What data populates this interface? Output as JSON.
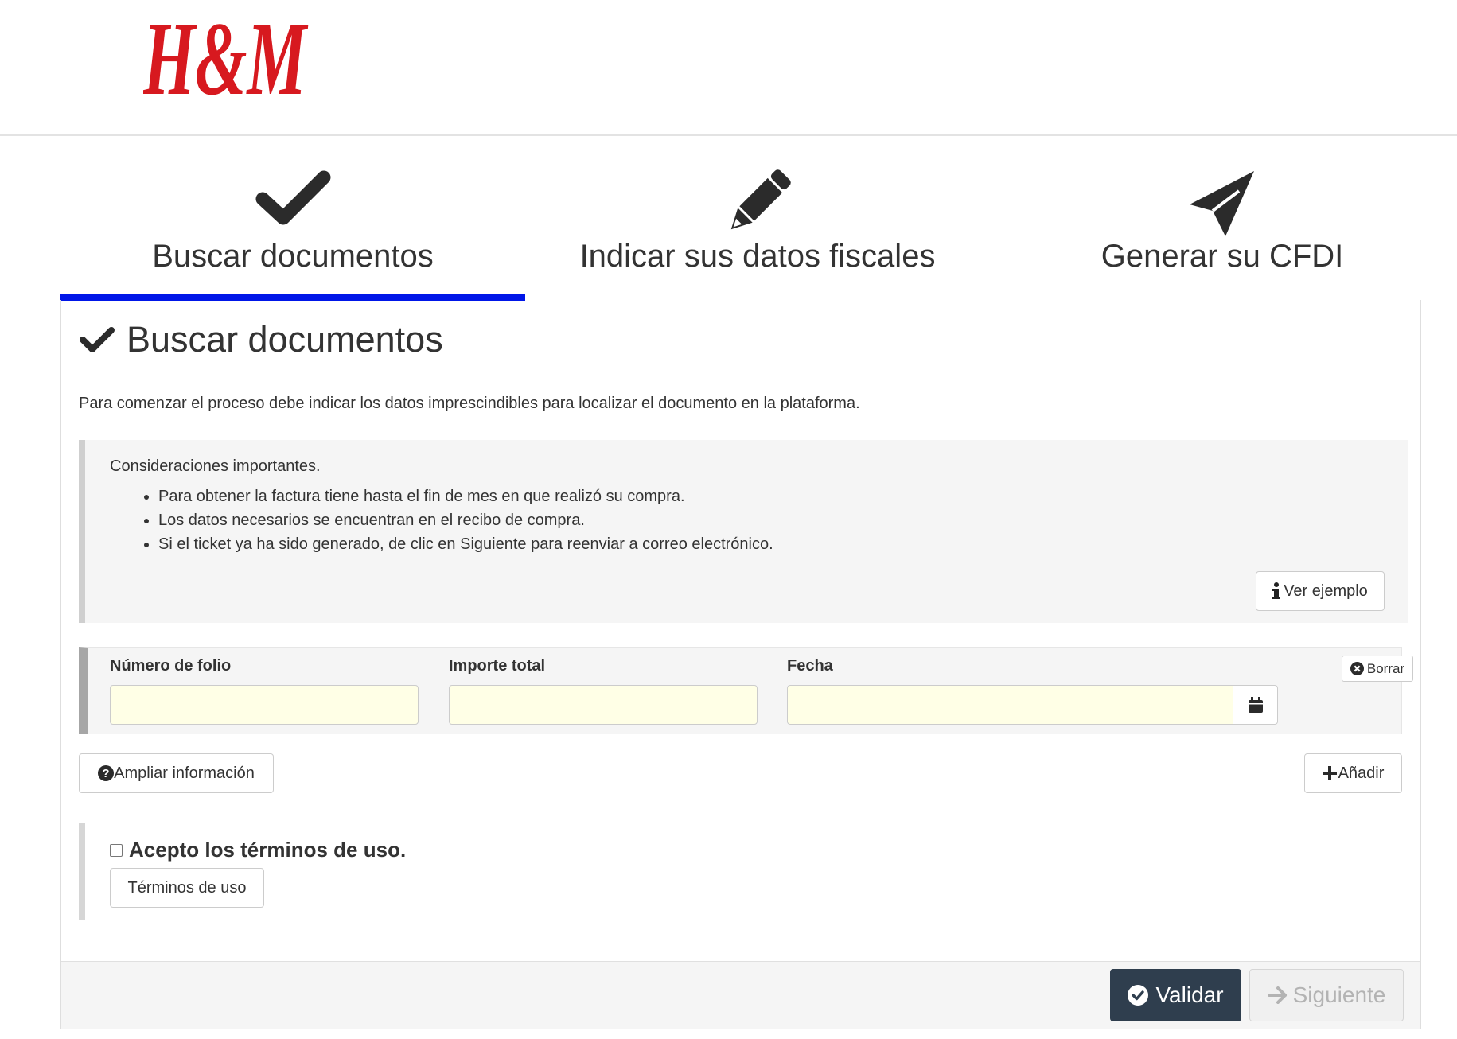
{
  "brand": {
    "logo_text": "H&M",
    "logo_color": "#d7191f"
  },
  "steps": [
    {
      "label": "Buscar documentos",
      "icon": "check-icon",
      "active": true
    },
    {
      "label": "Indicar sus datos fiscales",
      "icon": "pencil-icon",
      "active": false
    },
    {
      "label": "Generar su CFDI",
      "icon": "paper-plane-icon",
      "active": false
    }
  ],
  "accent_color": "#0016e8",
  "section": {
    "title": "Buscar documentos",
    "intro": "Para comenzar el proceso debe indicar los datos imprescindibles para localizar el documento en la plataforma."
  },
  "considerations": {
    "title": "Consideraciones importantes.",
    "items": [
      "Para obtener la factura tiene hasta el fin de mes en que realizó su compra.",
      "Los datos necesarios se encuentran en el recibo de compra.",
      "Si el ticket ya ha sido generado, de clic en Siguiente para reenviar a correo electrónico."
    ],
    "example_button": "Ver ejemplo"
  },
  "form": {
    "folio_label": "Número de folio",
    "folio_value": "",
    "importe_label": "Importe total",
    "importe_value": "",
    "fecha_label": "Fecha",
    "fecha_value": "",
    "clear_button": "Borrar"
  },
  "actions": {
    "more_info": "Ampliar información",
    "add": "Añadir"
  },
  "terms": {
    "checkbox_label": "Acepto los términos de uso.",
    "checked": false,
    "button": "Términos de uso"
  },
  "footer": {
    "validate": "Validar",
    "next": "Siguiente",
    "validate_color": "#2f3e4e"
  }
}
